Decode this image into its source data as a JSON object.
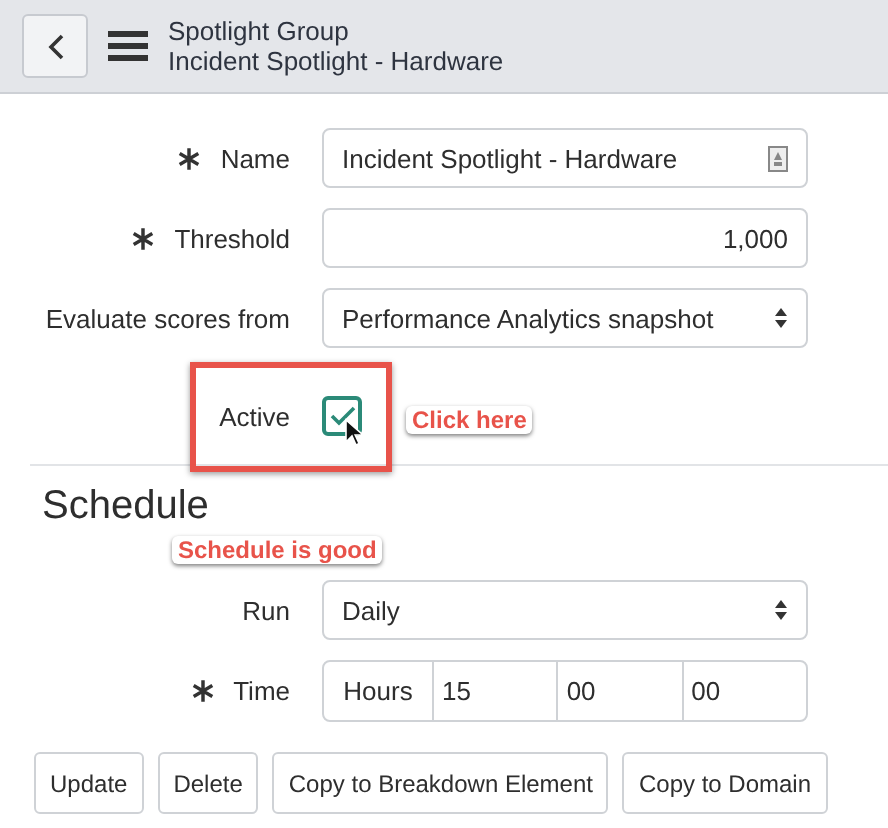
{
  "header": {
    "title": "Spotlight Group",
    "subtitle": "Incident Spotlight - Hardware"
  },
  "fields": [
    {
      "kind": "text",
      "label": "Name",
      "required": true,
      "value": "Incident Spotlight - Hardware"
    },
    {
      "kind": "number",
      "label": "Threshold",
      "required": true,
      "value": "1,000"
    },
    {
      "kind": "select",
      "label": "Evaluate scores from",
      "required": false,
      "value": "Performance Analytics snapshot"
    },
    {
      "kind": "checkbox",
      "label": "Active",
      "required": false,
      "checked": true,
      "highlighted": true,
      "callout": "Click here"
    }
  ],
  "schedule": {
    "heading": "Schedule",
    "note": "Schedule is good",
    "fields": [
      {
        "kind": "select",
        "label": "Run",
        "required": false,
        "value": "Daily"
      },
      {
        "kind": "time",
        "label": "Time",
        "required": true,
        "unit": "Hours",
        "parts": [
          "15",
          "00",
          "00"
        ]
      }
    ]
  },
  "buttons": [
    "Update",
    "Delete",
    "Copy to Breakdown Element",
    "Copy to Domain"
  ]
}
